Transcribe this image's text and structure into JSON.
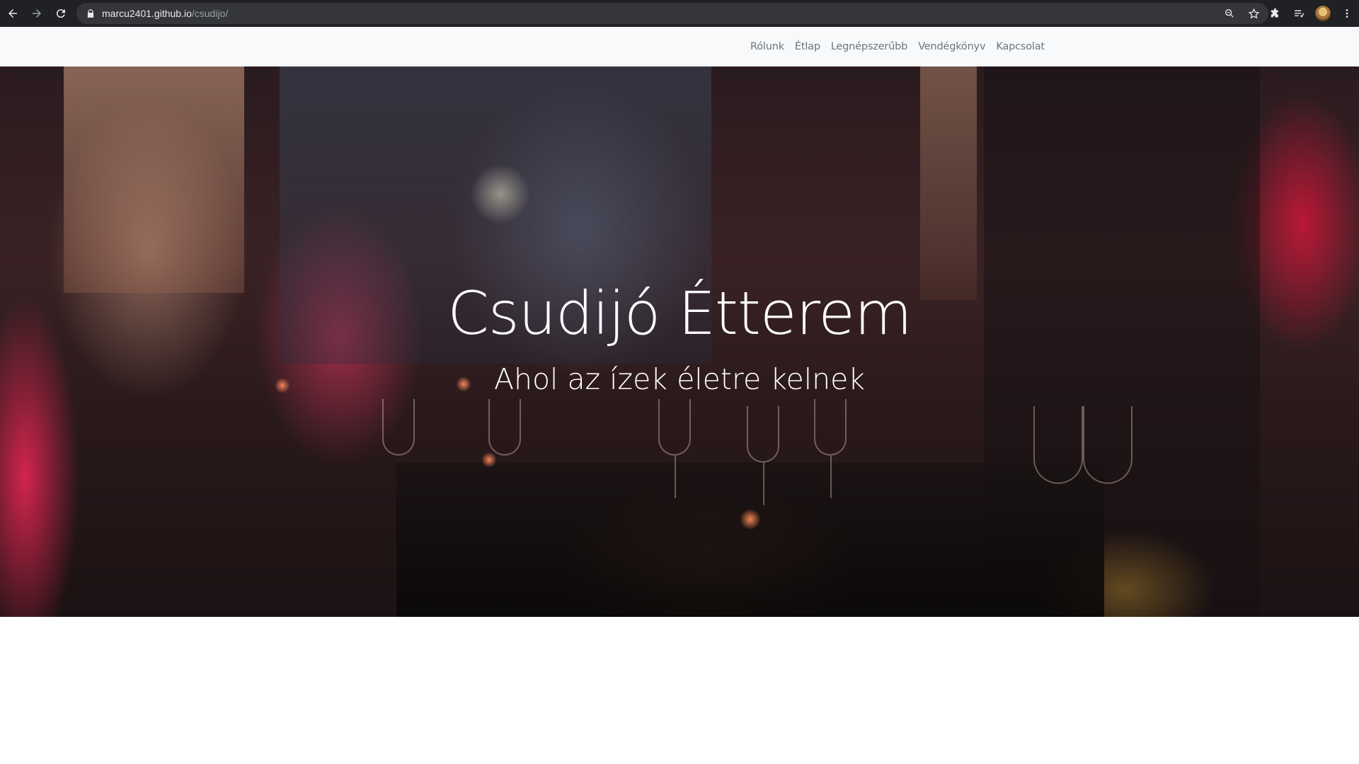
{
  "browser": {
    "url_host": "marcu2401.github.io",
    "url_path": "/csudijo/",
    "icons": [
      "back-arrow-icon",
      "forward-arrow-icon",
      "reload-icon",
      "lock-icon",
      "zoom-icon",
      "bookmark-star-icon",
      "extensions-icon",
      "reading-list-icon",
      "profile-avatar",
      "menu-dots-icon"
    ]
  },
  "navbar": {
    "links": [
      "Rólunk",
      "Étlap",
      "Legnépszerűbb",
      "Vendégkönyv",
      "Kapcsolat"
    ]
  },
  "hero": {
    "title": "Csudijó Étterem",
    "subtitle": "Ahol az ízek életre kelnek"
  },
  "colors": {
    "chrome_bg": "#202124",
    "omnibox_bg": "#35363a",
    "navbar_bg": "#f8f9fa",
    "nav_link": "#6c757d",
    "hero_text": "#ffffff"
  }
}
